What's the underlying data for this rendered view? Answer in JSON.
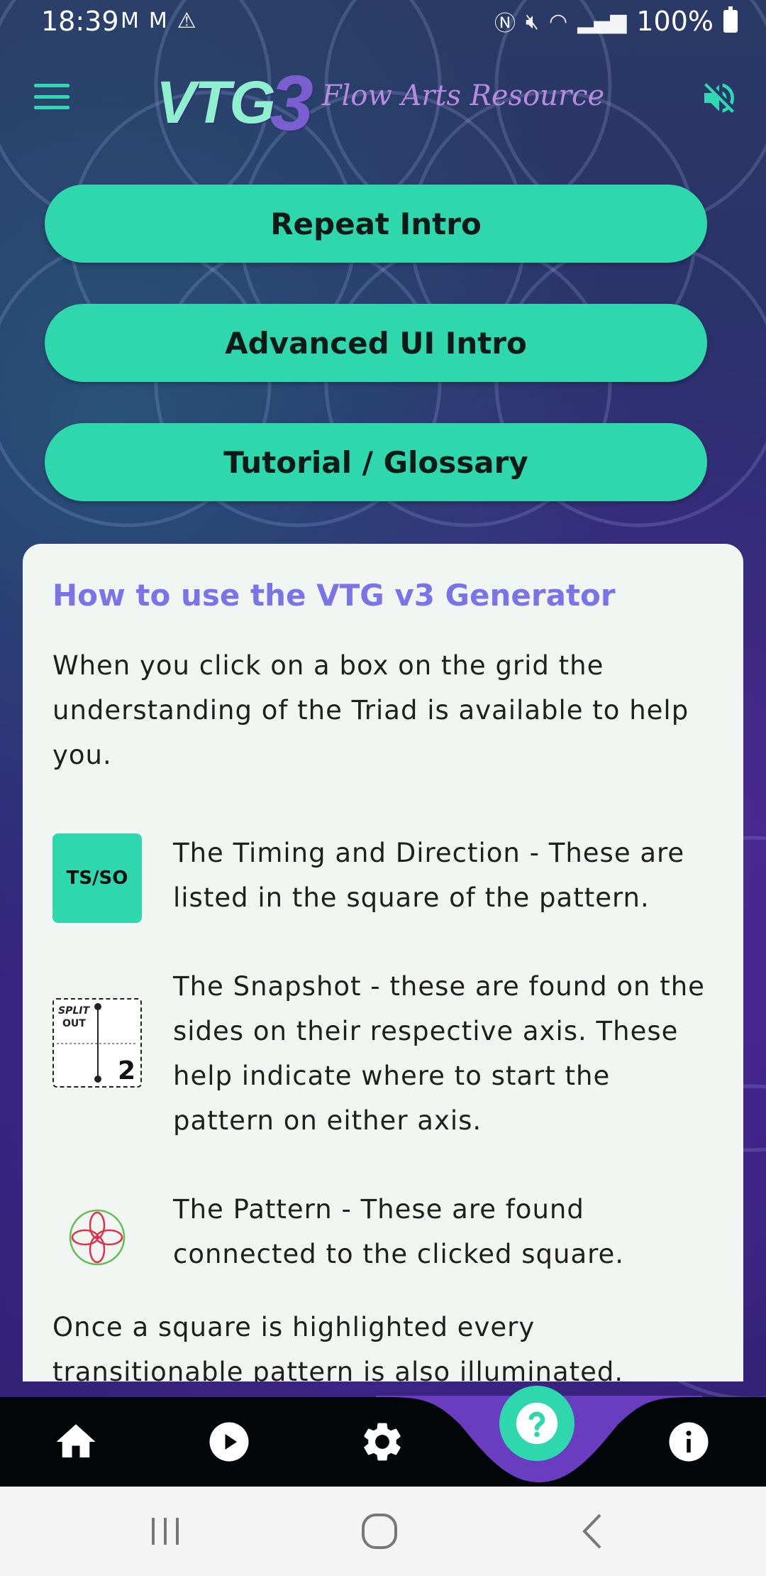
{
  "status_bar": {
    "time": "18:39",
    "left_icons": [
      "gmail-icon",
      "gmail-icon",
      "warning-icon"
    ],
    "right_icons": [
      "nfc-icon",
      "mute-icon",
      "wifi-icon",
      "signal-icon"
    ],
    "battery": "100%"
  },
  "header": {
    "logo_text": "VTG",
    "logo_number": "3",
    "logo_subtitle": "Flow Arts Resource",
    "menu_icon": "hamburger-icon",
    "sound_icon": "volume-off-icon"
  },
  "buttons": {
    "repeat_intro": "Repeat Intro",
    "advanced_ui_intro": "Advanced UI Intro",
    "tutorial_glossary": "Tutorial / Glossary"
  },
  "card": {
    "title": "How to use the VTG v3 Generator",
    "intro": "When you click on a box on the grid the understanding of the Triad is available to help you.",
    "items": [
      {
        "thumb_label": "TS/SO",
        "text": "The Timing and Direction - These are listed in the square of the pattern."
      },
      {
        "thumb_label_top": "SPLIT",
        "thumb_label_bottom": "OUT",
        "thumb_number": "2",
        "text": "The Snapshot - these are found on the sides on their respective axis. These help indicate where to start the pattern on either axis."
      },
      {
        "text": "The Pattern - These are found connected to the clicked square."
      }
    ],
    "outro": "Once a square is highlighted every transitionable pattern is also illuminated."
  },
  "bottom_nav": {
    "items": [
      "home-icon",
      "play-icon",
      "settings-icon",
      "help-icon",
      "info-icon"
    ],
    "active": "help-icon",
    "accent": "#6a3dc0",
    "fab_color": "#2ed8ac"
  }
}
